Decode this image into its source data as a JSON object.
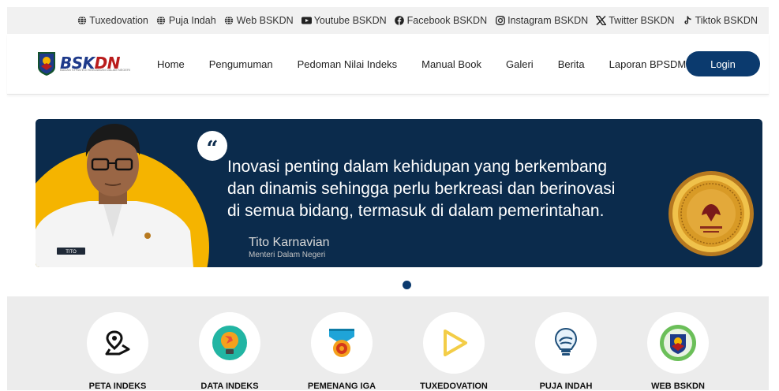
{
  "topbar": {
    "links": [
      {
        "label": "Tuxedovation",
        "icon": "globe-icon"
      },
      {
        "label": "Puja Indah",
        "icon": "globe-icon"
      },
      {
        "label": "Web BSKDN",
        "icon": "globe-icon"
      },
      {
        "label": "Youtube BSKDN",
        "icon": "youtube-icon"
      },
      {
        "label": "Facebook BSKDN",
        "icon": "facebook-icon"
      },
      {
        "label": "Instagram BSKDN",
        "icon": "instagram-icon"
      },
      {
        "label": "Twitter BSKDN",
        "icon": "x-icon"
      },
      {
        "label": "Tiktok BSKDN",
        "icon": "tiktok-icon"
      }
    ]
  },
  "navbar": {
    "logo_text": "BSK",
    "logo_text_accent": "DN",
    "logo_subtitle": "BADAN STRATEGI KEBIJAKAN DALAM NEGERI",
    "menu": [
      "Home",
      "Pengumuman",
      "Pedoman Nilai Indeks",
      "Manual Book",
      "Galeri",
      "Berita",
      "Laporan BPSDM"
    ],
    "login_label": "Login"
  },
  "banner": {
    "quote_lines": [
      "Inovasi penting dalam kehidupan yang berkembang",
      "dan dinamis sehingga perlu berkreasi dan berinovasi",
      "di semua bidang, termasuk di dalam pemerintahan."
    ],
    "author": "Tito Karnavian",
    "role": "Menteri Dalam Negeri",
    "name_tag": "TITO",
    "colors": {
      "background": "#0b2b4c",
      "accent": "#f5b400"
    }
  },
  "carousel": {
    "active_index": 0,
    "count": 1
  },
  "features": [
    {
      "label": "PETA INDEKS",
      "icon": "map-pin-icon"
    },
    {
      "label": "DATA INDEKS",
      "icon": "lightbulb-icon"
    },
    {
      "label": "PEMENANG IGA",
      "icon": "medal-icon"
    },
    {
      "label": "TUXEDOVATION",
      "icon": "play-icon"
    },
    {
      "label": "PUJA INDAH",
      "icon": "bulb-hand-icon"
    },
    {
      "label": "WEB BSKDN",
      "icon": "emblem-icon"
    }
  ]
}
